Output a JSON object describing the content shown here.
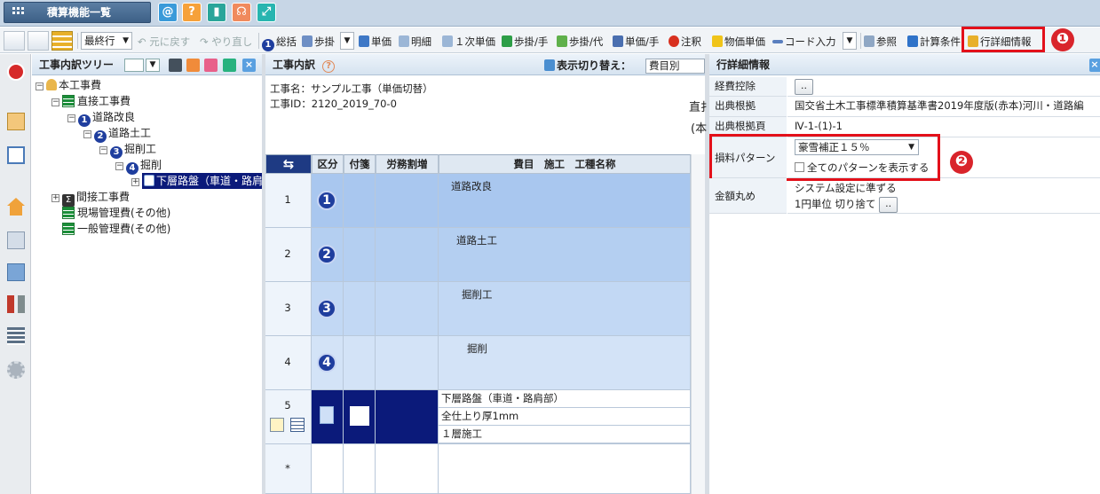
{
  "header": {
    "menu_label": "積算機能一覧",
    "quick_icons": [
      "at-icon",
      "help-icon",
      "bookmark-icon",
      "support-icon",
      "expand-icon"
    ]
  },
  "toolbar": {
    "row_select": "最終行",
    "undo": "元に戻す",
    "redo": "やり直し",
    "items": [
      "総括",
      "歩掛",
      "単価",
      "明細",
      "１次単価",
      "歩掛/手",
      "歩掛/代",
      "単価/手",
      "注釈",
      "物価単価",
      "コード入力",
      "参照",
      "計算条件",
      "行詳細情報"
    ],
    "badge1": "❶",
    "badge2": "❷"
  },
  "tree": {
    "title": "工事内訳ツリー",
    "nodes": [
      {
        "label": "本工事費"
      },
      {
        "label": "直接工事費"
      },
      {
        "label": "道路改良",
        "num": "1"
      },
      {
        "label": "道路土工",
        "num": "2"
      },
      {
        "label": "掘削工",
        "num": "3"
      },
      {
        "label": "掘削",
        "num": "4"
      },
      {
        "label": "下層路盤（車道・路肩"
      },
      {
        "label": "間接工事費"
      },
      {
        "label": "現場管理費(その他)"
      },
      {
        "label": "一般管理費(その他)"
      }
    ]
  },
  "center": {
    "title": "工事内訳",
    "switch_label": "表示切り替え：",
    "switch_value": "費目別",
    "project_name": "工事名：サンプル工事（単価切替）",
    "project_id": "工事ID：2120_2019_70-0",
    "cut_text1": "直扌",
    "cut_text2": "(本",
    "grid_headers": [
      "区分",
      "付箋",
      "労務割増",
      "費目　施工　工種名称"
    ],
    "rows": [
      {
        "no": "1",
        "num": "1",
        "name": "道路改良"
      },
      {
        "no": "2",
        "num": "2",
        "name": "道路土工"
      },
      {
        "no": "3",
        "num": "3",
        "name": "掘削工"
      },
      {
        "no": "4",
        "num": "4",
        "name": "掘削"
      },
      {
        "no": "5",
        "lines": [
          "下層路盤（車道・路肩部）",
          "全仕上り厚1mm",
          "１層施工"
        ]
      },
      {
        "no": "*"
      }
    ]
  },
  "detail": {
    "title": "行詳細情報",
    "rows": [
      {
        "label": "経費控除",
        "button": ".."
      },
      {
        "label": "出典根拠",
        "value": "国交省土木工事標準積算基準書2019年度版(赤本)河川・道路編"
      },
      {
        "label": "出典根拠頁",
        "value": "Ⅳ-1-(1)-1"
      },
      {
        "label": "損料パターン",
        "select": "豪雪補正１５％",
        "checkbox": "全てのパターンを表示する"
      },
      {
        "label": "金額丸め",
        "value": "システム設定に準ずる",
        "value2": "1円単位 切り捨て",
        "button": ".."
      }
    ]
  },
  "colors": {
    "accent": "#1f3e9e",
    "highlight": "#e3101a",
    "selected": "#0b1a7a"
  }
}
